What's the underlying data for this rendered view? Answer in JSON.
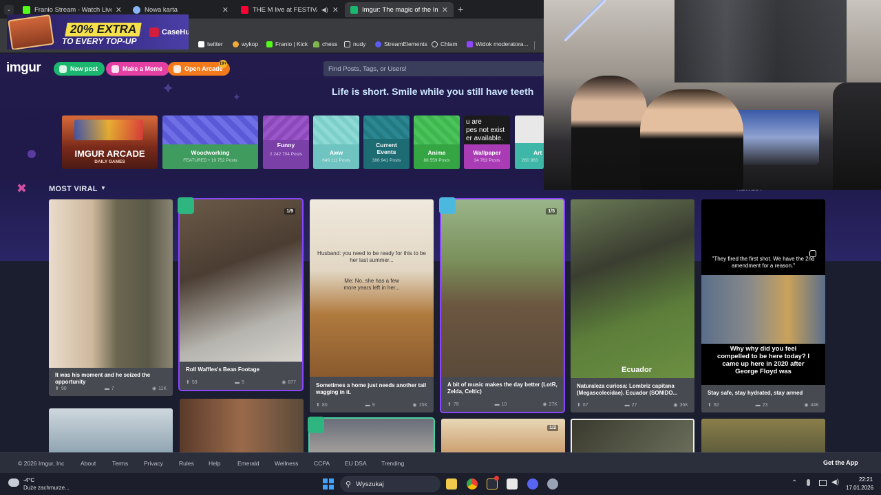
{
  "browser": {
    "tabs": [
      {
        "title": "Franio Stream - Watch Live on Kick",
        "icon": "kick-icon",
        "color": "#53fc18"
      },
      {
        "title": "Nowa karta",
        "icon": "globe-icon",
        "color": "#8ab4f8"
      },
      {
        "title": "THE M live at FESTIVALAND",
        "icon": "youtube-icon",
        "color": "#ff0033"
      },
      {
        "title": "Imgur: The magic of the Internet",
        "icon": "imgur-icon",
        "color": "#1bb76e"
      }
    ],
    "new_tab": "+",
    "bookmarks": [
      {
        "label": "twitter",
        "icon": "x-icon"
      },
      {
        "label": "wykop",
        "icon": "wykop-icon"
      },
      {
        "label": "Franio | Kick",
        "icon": "kick-icon"
      },
      {
        "label": "chess",
        "icon": "pawn-icon"
      },
      {
        "label": "nudy",
        "icon": "folder-icon"
      },
      {
        "label": "StreamElements",
        "icon": "streamelements-icon"
      },
      {
        "label": "Chlam",
        "icon": "globe-icon"
      },
      {
        "label": "Widok moderatora...",
        "icon": "twitch-icon"
      }
    ]
  },
  "ad": {
    "headline": "20% EXTRA",
    "subline": "TO EVERY TOP-UP",
    "brand": "CaseHug"
  },
  "imgur": {
    "logo": "imgur",
    "buttons": {
      "new_post": "New post",
      "make_meme": "Make a Meme",
      "open_arcade": "Open Arcade",
      "badge": "19+"
    },
    "search_placeholder": "Find Posts, Tags, or Users!",
    "tagline": "Life is short. Smile while you still have teeth",
    "tags": [
      {
        "name": "IMGUR ARCADE",
        "sub": "DAILY GAMES"
      },
      {
        "name": "Woodworking",
        "sub": "FEATURED • 19 752 Posts"
      },
      {
        "name": "Funny",
        "sub": "2 242 704 Posts"
      },
      {
        "name": "Aww",
        "sub": "649 111 Posts"
      },
      {
        "name": "Current Events",
        "sub": "386 941 Posts"
      },
      {
        "name": "Anime",
        "sub": "88 559 Posts"
      },
      {
        "name": "Wallpaper",
        "sub": "34 763 Posts",
        "overlay": "u are\npes not exist\ner available."
      },
      {
        "name": "Art",
        "sub": "260 363"
      }
    ],
    "section": {
      "title": "MOST VIRAL",
      "sort": "NEWEST"
    },
    "cards": [
      {
        "caption": "It was his moment and he seized the opportunity",
        "up": "90",
        "comments": "7",
        "views": "11K"
      },
      {
        "caption": "Roll Waffles's Bean Footage",
        "up": "59",
        "comments": "5",
        "views": "877",
        "count": "1/9"
      },
      {
        "caption": "Sometimes a home just needs another tail wagging in it.",
        "up": "80",
        "comments": "9",
        "views": "15K",
        "image_text_1": "Husband: you need to be ready for this to be her last summer...",
        "image_text_2": "Me: No, she has a few more years left in her..."
      },
      {
        "caption": "A bit of music makes the day better (LotR, Zelda, Celtic)",
        "up": "78",
        "comments": "10",
        "views": "27K",
        "count": "1/5"
      },
      {
        "caption": "Naturaleza curiosa: Lombriz capitana (Megascolecidae). Ecuador (SONIDO...",
        "up": "67",
        "comments": "27",
        "views": "36K",
        "image_text": "Ecuador"
      },
      {
        "caption": "Stay safe, stay hydrated, stay armed",
        "up": "92",
        "comments": "23",
        "views": "44K",
        "image_text_top": "\"They fired the first shot. We have the 2nd amendment for a reason.\"",
        "image_text_bottom": "Why why did you feel compelled to be here today? I came up here in 2020 after George Floyd was"
      }
    ],
    "second_row_count": "1/2",
    "footer": {
      "copyright": "© 2026 Imgur, Inc",
      "links": [
        "About",
        "Terms",
        "Privacy",
        "Rules",
        "Help",
        "Emerald",
        "Wellness",
        "CCPA",
        "EU DSA",
        "Trending"
      ],
      "get_app": "Get the App"
    }
  },
  "taskbar": {
    "weather_temp": "-4°C",
    "weather_desc": "Duże zachmurze...",
    "search": "Wyszukaj",
    "time": "22:21",
    "date": "17.01.2026"
  },
  "colors": {
    "new_post": "#1bb76e",
    "meme": "#e43fa3",
    "arcade": "#f27a1b",
    "hero": "#221b4b"
  }
}
